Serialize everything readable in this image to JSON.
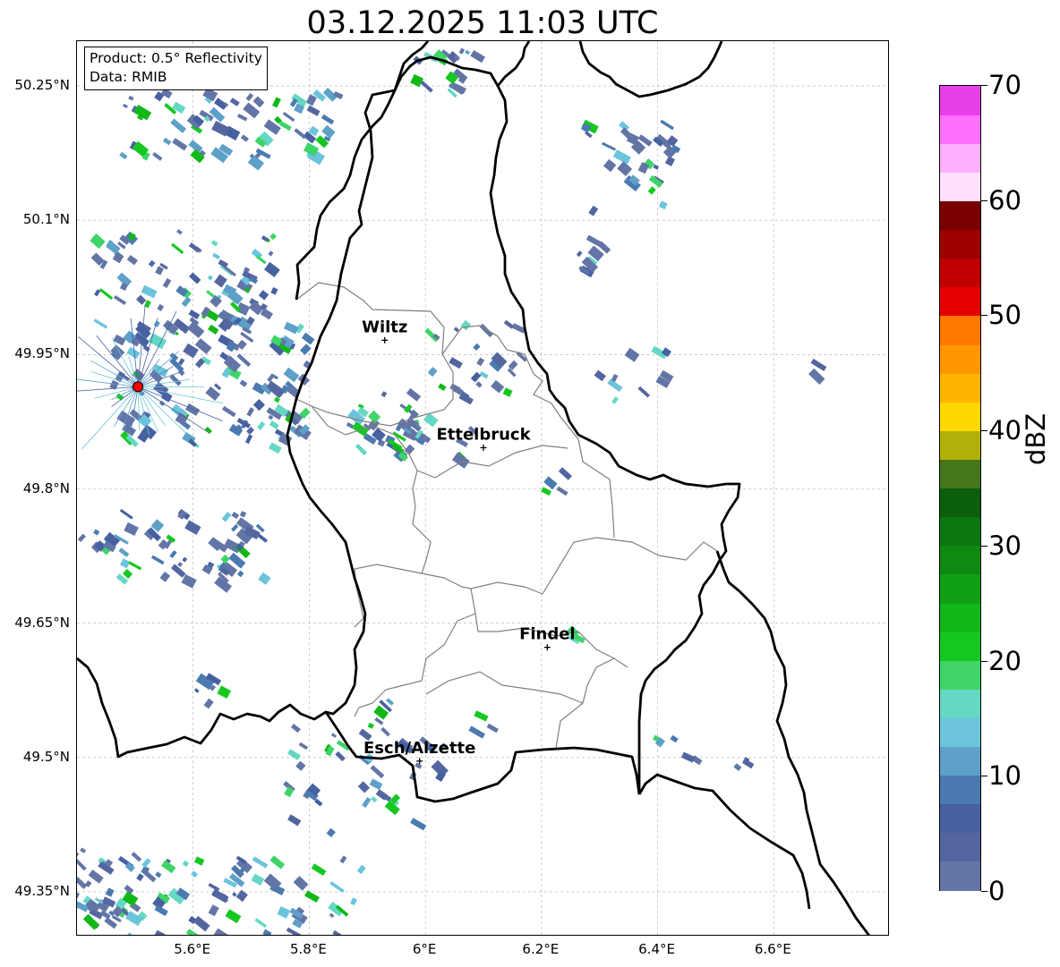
{
  "map": {
    "title": "03.12.2025 11:03 UTC",
    "info_box": {
      "product_line": "Product: 0.5° Reflectivity",
      "data_line": "Data: RMIB"
    },
    "lat_ticks": [
      "50.25°N",
      "50.1°N",
      "49.95°N",
      "49.8°N",
      "49.65°N",
      "49.5°N",
      "49.35°N"
    ],
    "lat_values": [
      50.25,
      50.1,
      49.95,
      49.8,
      49.65,
      49.5,
      49.35
    ],
    "lon_ticks": [
      "5.6°E",
      "5.8°E",
      "6°E",
      "6.2°E",
      "6.4°E",
      "6.6°E"
    ],
    "lon_values": [
      5.6,
      5.8,
      6.0,
      6.2,
      6.4,
      6.6
    ],
    "extent": {
      "lon_min": 5.4,
      "lon_max": 6.8,
      "lat_min": 49.3,
      "lat_max": 50.3
    },
    "cities": [
      {
        "name": "Wiltz",
        "lon": 5.93,
        "lat": 49.966
      },
      {
        "name": "Ettelbruck",
        "lon": 6.1,
        "lat": 49.846
      },
      {
        "name": "Findel",
        "lon": 6.21,
        "lat": 49.623
      },
      {
        "name": "Esch/Alzette",
        "lon": 5.99,
        "lat": 49.496
      }
    ],
    "radar_site": {
      "lon": 5.505,
      "lat": 49.914
    },
    "colors": {
      "border": "#000000",
      "cantons": "#808080",
      "grid": "#b0b0b0",
      "radar_marker": "#ff0000"
    },
    "colorbar": {
      "label": "dBZ",
      "ticks": [
        "0",
        "10",
        "20",
        "30",
        "40",
        "50",
        "60",
        "70"
      ],
      "min": 0,
      "max": 70,
      "colors": [
        "#6375a6",
        "#5466a0",
        "#4660a0",
        "#4a7ab0",
        "#5da0c8",
        "#6cc4dc",
        "#64d8c4",
        "#3ed468",
        "#15c820",
        "#12b818",
        "#10a014",
        "#0e8a10",
        "#0c7610",
        "#0a5e0c",
        "#46761a",
        "#b0b008",
        "#ffd800",
        "#ffb400",
        "#ff9600",
        "#ff7800",
        "#e40000",
        "#c00000",
        "#9c0000",
        "#7a0000",
        "#ffe0ff",
        "#ffb0ff",
        "#ff70ff",
        "#e840e8"
      ]
    }
  }
}
